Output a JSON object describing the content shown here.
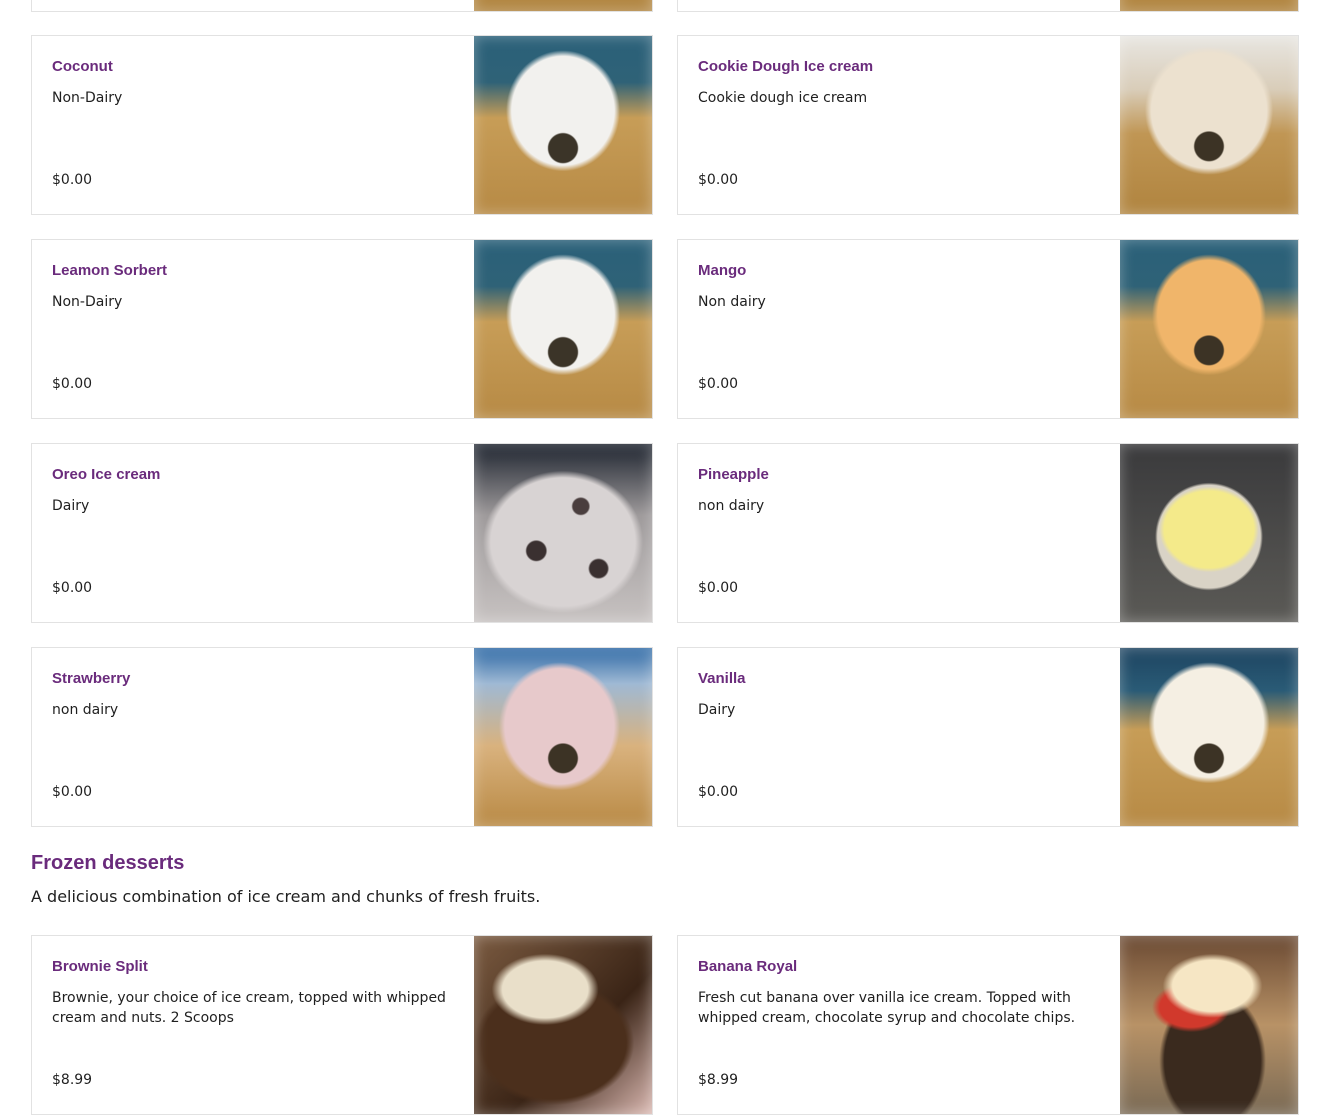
{
  "items": [
    {
      "name": "Coconut",
      "desc": "Non-Dairy",
      "price": "$0.00",
      "image": "white-scoop-image"
    },
    {
      "name": "Cookie Dough Ice cream",
      "desc": "Cookie dough ice cream",
      "price": "$0.00",
      "image": "beige-scoop-image"
    },
    {
      "name": "Leamon Sorbert",
      "desc": "Non-Dairy",
      "price": "$0.00",
      "image": "white-scoop-image"
    },
    {
      "name": "Mango",
      "desc": "Non dairy",
      "price": "$0.00",
      "image": "mango-scoop-image"
    },
    {
      "name": "Oreo Ice cream",
      "desc": "Dairy",
      "price": "$0.00",
      "image": "oreo-scoop-image"
    },
    {
      "name": "Pineapple",
      "desc": "non dairy",
      "price": "$0.00",
      "image": "pineapple-scoop-image"
    },
    {
      "name": "Strawberry",
      "desc": "non dairy",
      "price": "$0.00",
      "image": "strawberry-scoop-image"
    },
    {
      "name": "Vanilla",
      "desc": "Dairy",
      "price": "$0.00",
      "image": "vanilla-scoop-image"
    }
  ],
  "section": {
    "title": "Frozen desserts",
    "description": "A delicious combination of ice cream and chunks of fresh fruits."
  },
  "frozen_items": [
    {
      "name": "Brownie Split",
      "desc": "Brownie, your choice of ice cream, topped with whipped cream and nuts. 2 Scoops",
      "price": "$8.99",
      "image": "brownie-split-image"
    },
    {
      "name": "Banana Royal",
      "desc": "Fresh cut banana over vanilla ice cream. Topped with whipped cream, chocolate syrup and chocolate chips.",
      "price": "$8.99",
      "image": "banana-royal-image"
    }
  ],
  "colors": {
    "accent": "#6a2b7c",
    "border": "#e2e2e2"
  }
}
